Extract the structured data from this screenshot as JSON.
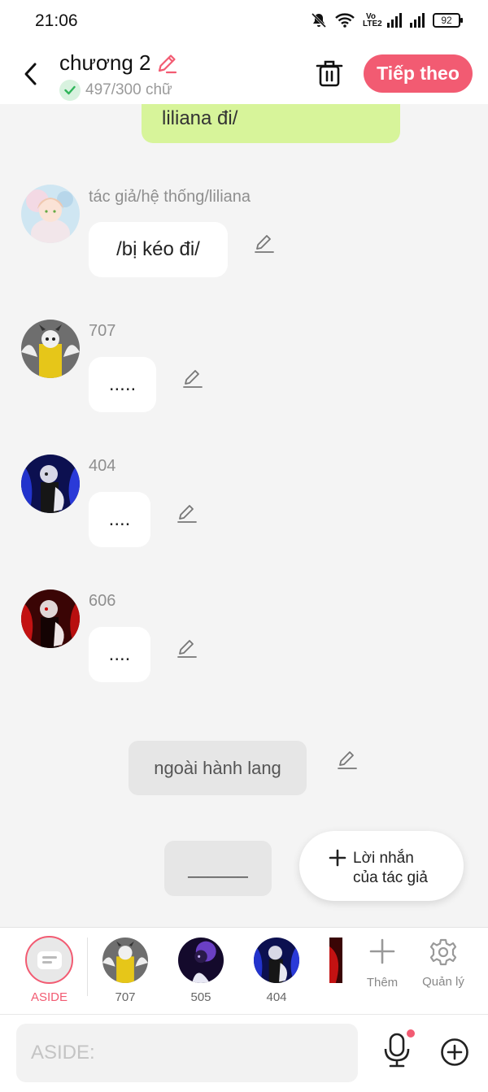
{
  "status_bar": {
    "time": "21:06",
    "network": "Vo LTE2",
    "battery": "92"
  },
  "header": {
    "title": "chương 2",
    "word_count": "497/300 chữ",
    "next_label": "Tiếp theo"
  },
  "messages": [
    {
      "type": "self",
      "text": "liliana đi/"
    },
    {
      "type": "character",
      "name": "tác giả/hệ thống/liliana",
      "text": "/bị kéo đi/",
      "avatar": "liliana-avatar"
    },
    {
      "type": "character",
      "name": "707",
      "text": ".....",
      "avatar": "707-avatar"
    },
    {
      "type": "character",
      "name": "404",
      "text": "....",
      "avatar": "404-avatar"
    },
    {
      "type": "character",
      "name": "606",
      "text": "....",
      "avatar": "606-avatar"
    },
    {
      "type": "narration",
      "text": "ngoài hành lang"
    },
    {
      "type": "aside",
      "text": "______"
    }
  ],
  "author_note_button": {
    "line1": "Lời nhắn",
    "line2": "của tác giả"
  },
  "character_bar": {
    "aside_label": "ASIDE",
    "characters": [
      {
        "label": "707"
      },
      {
        "label": "505"
      },
      {
        "label": "404"
      }
    ],
    "add_label": "Thêm",
    "manage_label": "Quản lý"
  },
  "input": {
    "placeholder": "ASIDE:"
  },
  "colors": {
    "accent": "#f25b72",
    "self_bubble": "#d7f49a",
    "background": "#f4f4f4"
  }
}
